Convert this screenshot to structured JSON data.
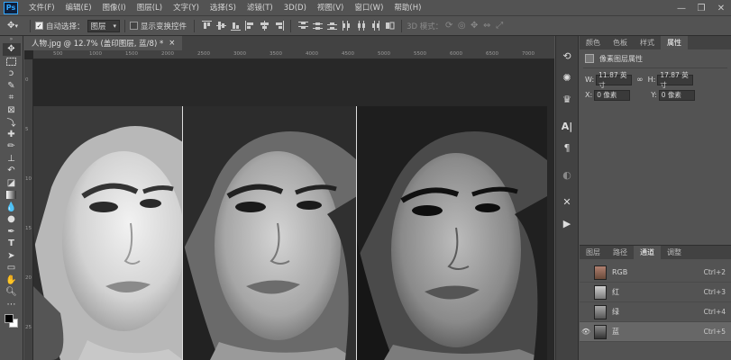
{
  "menu": {
    "logo": "Ps",
    "items": [
      "文件(F)",
      "编辑(E)",
      "图像(I)",
      "图层(L)",
      "文字(Y)",
      "选择(S)",
      "滤镜(T)",
      "3D(D)",
      "视图(V)",
      "窗口(W)",
      "帮助(H)"
    ]
  },
  "window_controls": {
    "minimize": "—",
    "restore": "❐",
    "close": "✕"
  },
  "options": {
    "auto_select_label": "自动选择：",
    "auto_select_value": "图层",
    "show_transform_label": "显示变换控件",
    "mode_3d_label": "3D 模式："
  },
  "document": {
    "tab_title": "人物.jpg @ 12.7% (盖印图层, 蓝/8) *",
    "close": "×",
    "ruler_top": [
      "500",
      "1000",
      "1500",
      "2000",
      "2500",
      "3000",
      "3500",
      "4000",
      "4500",
      "5000",
      "5500",
      "6000",
      "6500",
      "7000"
    ],
    "ruler_left": [
      "0",
      "5",
      "10",
      "15",
      "20",
      "25"
    ]
  },
  "properties": {
    "tabs": [
      "颜色",
      "色板",
      "样式",
      "属性"
    ],
    "title": "像素图层属性",
    "w_label": "W:",
    "w_value": "11.87 英寸",
    "h_label": "H:",
    "h_value": "17.87 英寸",
    "x_label": "X:",
    "x_value": "0 像素",
    "y_label": "Y:",
    "y_value": "0 像素",
    "link_icon": "∞"
  },
  "channels": {
    "tabs": [
      "图层",
      "路径",
      "通道",
      "调整"
    ],
    "rows": [
      {
        "name": "RGB",
        "shortcut": "Ctrl+2",
        "visible": false
      },
      {
        "name": "红",
        "shortcut": "Ctrl+3",
        "visible": false
      },
      {
        "name": "绿",
        "shortcut": "Ctrl+4",
        "visible": false
      },
      {
        "name": "蓝",
        "shortcut": "Ctrl+5",
        "visible": true
      }
    ],
    "eye": "👁"
  },
  "colors": {
    "accent": "#31a8ff",
    "panel_bg": "#535353",
    "dark_bg": "#282828",
    "selected_row": "#676767"
  }
}
